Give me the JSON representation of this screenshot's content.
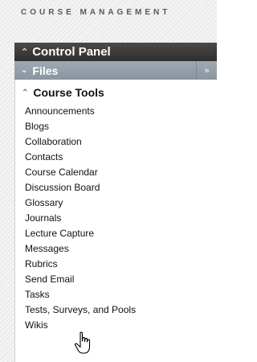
{
  "module_title": "COURSE MANAGEMENT",
  "control_panel": {
    "label": "Control Panel",
    "icon": "chevron-up-icon"
  },
  "files": {
    "label": "Files",
    "icon": "chevron-down-icon",
    "expand_icon": "double-chevron-right-icon"
  },
  "course_tools": {
    "label": "Course Tools",
    "icon": "chevron-up-icon",
    "items": [
      "Announcements",
      "Blogs",
      "Collaboration",
      "Contacts",
      "Course Calendar",
      "Discussion Board",
      "Glossary",
      "Journals",
      "Lecture Capture",
      "Messages",
      "Rubrics",
      "Send Email",
      "Tasks",
      "Tests, Surveys, and Pools",
      "Wikis"
    ]
  },
  "cursor": "hand-pointer-icon",
  "colors": {
    "header_bg": "#3a3a3a",
    "files_bg": "#939da8",
    "list_bg": "#ffffff"
  }
}
